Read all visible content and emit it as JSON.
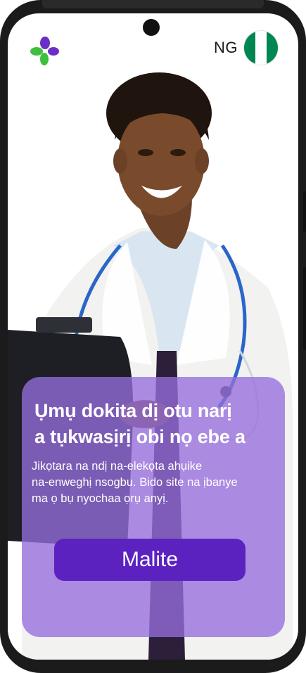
{
  "header": {
    "logo_icon": "plus-cross-logo-icon",
    "country_code": "NG",
    "flag_colors": [
      "#008751",
      "#ffffff",
      "#008751"
    ]
  },
  "hero": {
    "headline_line1": "Ụmụ dokita dị otu narị",
    "headline_line2": "a tụkwasịrị obi nọ ebe a",
    "subtext_line1": "Jikọtara na ndị na-elekọta ahụike",
    "subtext_line2": "na-enweghị nsogbu. Bido site na ịbanye",
    "subtext_line3": "ma ọ bụ nyochaa ọrụ anyị.",
    "cta_label": "Malite"
  },
  "colors": {
    "logo_purple": "#6a2fc6",
    "logo_green": "#3fbf3f",
    "card": "#966edc",
    "cta": "#5b22c0"
  }
}
